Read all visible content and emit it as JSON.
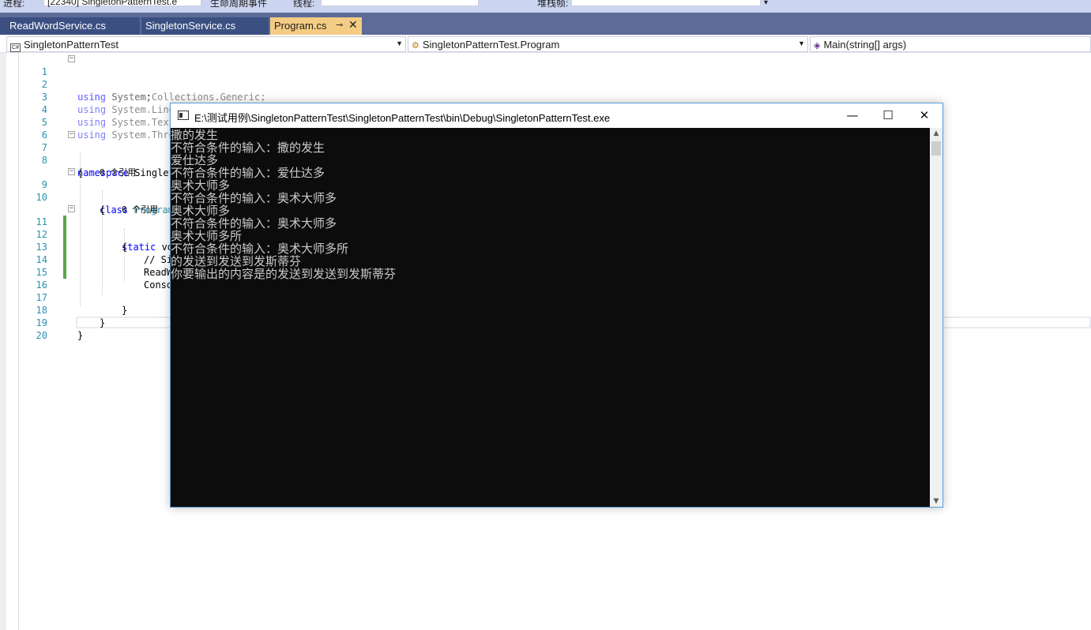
{
  "toolbar": {
    "process_label": "进程:",
    "process_value": "[22340] SingletonPatternTest.e",
    "lifecycle_label": "生命周期事件",
    "thread_label": "线程:",
    "stack_label": "堆栈帧:"
  },
  "tabs": [
    {
      "label": "ReadWordService.cs",
      "active": false
    },
    {
      "label": "SingletonService.cs",
      "active": false
    },
    {
      "label": "Program.cs",
      "active": true
    }
  ],
  "navbar": {
    "project": "SingletonPatternTest",
    "type": "SingletonPatternTest.Program",
    "member": "Main(string[] args)"
  },
  "editor": {
    "lines": [
      {
        "n": "1"
      },
      {
        "n": "2"
      },
      {
        "n": "3"
      },
      {
        "n": "4"
      },
      {
        "n": "5"
      },
      {
        "n": "6"
      },
      {
        "n": "7"
      },
      {
        "n": "8"
      },
      {
        "n": "9"
      },
      {
        "n": "10"
      },
      {
        "n": "11"
      },
      {
        "n": "12"
      },
      {
        "n": "13"
      },
      {
        "n": "14"
      },
      {
        "n": "15"
      },
      {
        "n": "16"
      },
      {
        "n": "17"
      },
      {
        "n": "18"
      },
      {
        "n": "19"
      },
      {
        "n": "20"
      }
    ],
    "code": {
      "l1_kw": "using",
      "l1_rest": " System;",
      "l2_kw": "using",
      "l2_rest": " System.Collections.Generic;",
      "l3_kw": "using",
      "l3_rest": " System.Linq;",
      "l4_kw": "using",
      "l4_rest": " System.Text;",
      "l5_kw": "using",
      "l5_rest": " System.Thre",
      "l7_kw": "namespace",
      "l7_rest": " Singlet",
      "l8": "{",
      "ref1": "0 个引用",
      "l9_kw": "class",
      "l9_type": " Program",
      "l10": "{",
      "ref2": "0 个引用",
      "l11_kw": "static",
      "l11_rest": " vo",
      "l12": "{",
      "l13": "// Si",
      "l14": "ReadW",
      "l15": "Conso",
      "l17": "}",
      "l18": "}",
      "l19": "}"
    }
  },
  "console": {
    "title": "E:\\测试用例\\SingletonPatternTest\\SingletonPatternTest\\bin\\Debug\\SingletonPatternTest.exe",
    "minimize": "—",
    "maximize": "☐",
    "close": "✕",
    "output": [
      "撒的发生",
      "不符合条件的输入：撒的发生",
      "爱仕达多",
      "不符合条件的输入：爱仕达多",
      "奥术大师多",
      "不符合条件的输入：奥术大师多",
      "奥术大师多",
      "不符合条件的输入：奥术大师多",
      "奥术大师多所",
      "不符合条件的输入：奥术大师多所",
      "的发送到发送到发斯蒂芬",
      "你要输出的内容是的发送到发送到发斯蒂芬"
    ]
  },
  "colors": {
    "tab_strip": "#5d6b99",
    "active_tab": "#f5cc84",
    "console_bg": "#0c0c0c",
    "console_text": "#cccccc",
    "keyword": "#0000ff",
    "type": "#2b91af"
  }
}
